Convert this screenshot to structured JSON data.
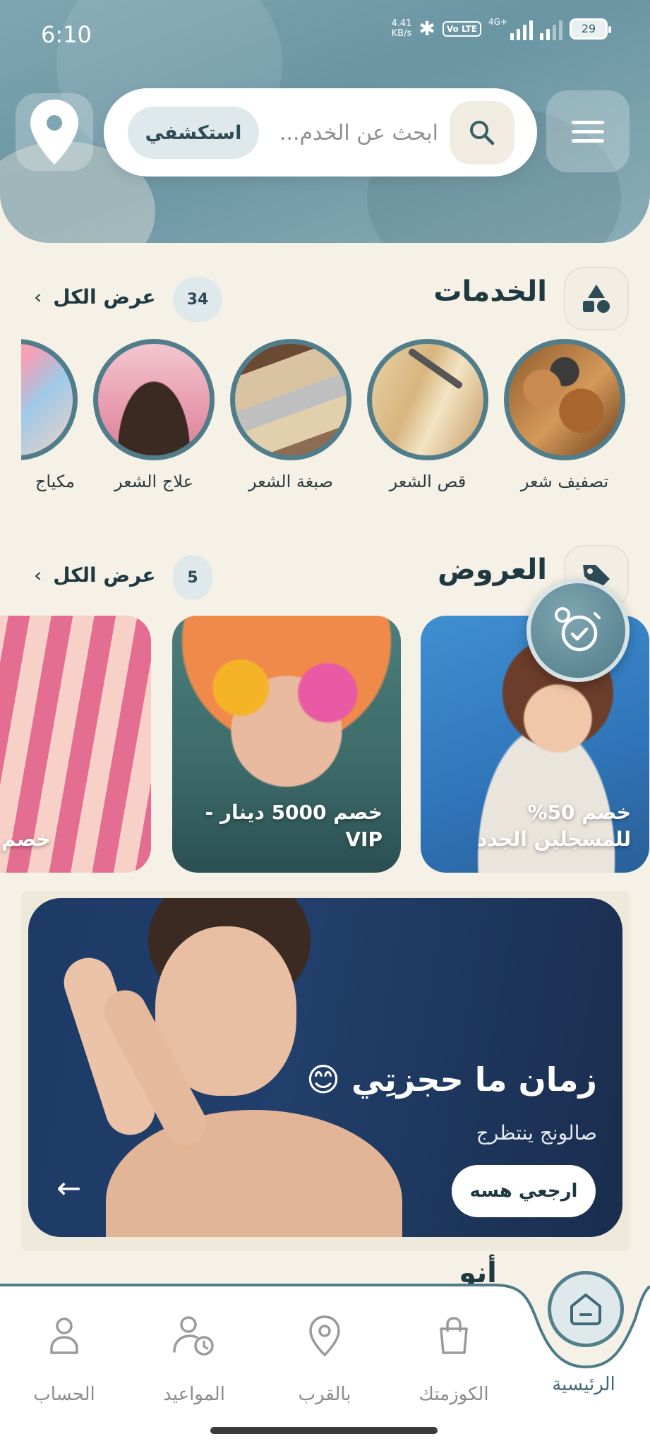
{
  "status_bar": {
    "time": "6:10",
    "net_speed_value": "4.41",
    "net_speed_unit": "KB/s",
    "volte": "Vo LTE",
    "signal_label": "4G+",
    "battery": "29"
  },
  "header": {
    "search_placeholder": "ابحث عن الخدم...",
    "explore_label": "استكشفي",
    "icons": [
      "menu-icon",
      "search-icon",
      "location-pin-icon"
    ]
  },
  "services_section": {
    "title": "الخدمات",
    "count": "34",
    "view_all": "عرض الكل",
    "items": [
      {
        "label": "تصفيف شعر"
      },
      {
        "label": "قص الشعر"
      },
      {
        "label": "صبغة الشعر"
      },
      {
        "label": "علاج الشعر"
      },
      {
        "label": "مكياج"
      }
    ]
  },
  "offers_section": {
    "title": "العروض",
    "count": "5",
    "view_all": "عرض الكل",
    "items": [
      {
        "title": "خصم 50%\nللمسجلين الجدد"
      },
      {
        "title": "خصم 5000 دينار -\nVIP"
      },
      {
        "title": "خصم"
      }
    ]
  },
  "banner": {
    "title": "زمان ما حجزتِي 😊",
    "subtitle": "صالونج ينتظرج",
    "cta": "ارجعي هسه"
  },
  "next_section_title": "أنو",
  "bottom_nav": {
    "items": [
      {
        "label": "الرئيسية",
        "icon": "home-icon",
        "active": true
      },
      {
        "label": "الكوزمتك",
        "icon": "shopping-bag-icon",
        "active": false
      },
      {
        "label": "بالقرب",
        "icon": "location-pin-icon",
        "active": false
      },
      {
        "label": "المواعيد",
        "icon": "user-clock-icon",
        "active": false
      },
      {
        "label": "الحساب",
        "icon": "user-icon",
        "active": false
      }
    ]
  }
}
